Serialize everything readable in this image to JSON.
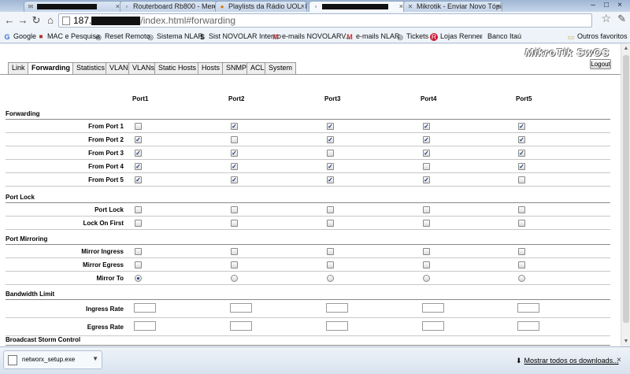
{
  "browser": {
    "tabs": [
      {
        "label": "",
        "icon": "mail-icon"
      },
      {
        "label": "Routerboard Rb800 - Merca",
        "icon": "page-icon"
      },
      {
        "label": "Playlists da Rádio UOL: Dan",
        "icon": "radio-icon"
      },
      {
        "label": "",
        "icon": "page-icon"
      },
      {
        "label": "Mikrotik - Enviar Novo Tópi",
        "icon": "tool-icon"
      }
    ],
    "tab_close": "×",
    "address": {
      "prefix": "187.",
      "rest": "/index.html#forwarding"
    },
    "bookmarks": [
      {
        "label": "Google",
        "icon": "google-icon"
      },
      {
        "label": "MAC e Pesquisa",
        "icon": "mac-icon"
      },
      {
        "label": "Reset Remoto",
        "icon": "globe-icon"
      },
      {
        "label": "Sistema NLAR",
        "icon": "globe-icon"
      },
      {
        "label": "Sist NOVOLAR Interno",
        "icon": "sist-icon"
      },
      {
        "label": "e-mails NOVOLARV...",
        "icon": "gmail-icon"
      },
      {
        "label": "e-mails NLAR",
        "icon": "gmail-icon"
      },
      {
        "label": "Tickets",
        "icon": "globe-icon"
      },
      {
        "label": "Lojas Renner",
        "icon": "renner-icon"
      },
      {
        "label": "Banco Itaú",
        "icon": "page-icon"
      },
      {
        "label": "Outros favoritos",
        "icon": "folder-icon"
      }
    ],
    "download": {
      "file": "networx_setup.exe"
    },
    "show_all_downloads": "Mostrar todos os downloads..."
  },
  "app": {
    "brand": "MikroTik SwOS",
    "logout": "Logout",
    "active_tab": "Forwarding",
    "tabs": [
      "Link",
      "Forwarding",
      "Statistics",
      "VLAN",
      "VLANs",
      "Static Hosts",
      "Hosts",
      "SNMP",
      "ACL",
      "System"
    ]
  },
  "ports": [
    "Port1",
    "Port2",
    "Port3",
    "Port4",
    "Port5"
  ],
  "sections": {
    "forwarding": {
      "title": "Forwarding",
      "rows": [
        {
          "label": "From Port 1",
          "values": [
            false,
            true,
            true,
            true,
            true
          ]
        },
        {
          "label": "From Port 2",
          "values": [
            true,
            false,
            true,
            true,
            true
          ]
        },
        {
          "label": "From Port 3",
          "values": [
            true,
            true,
            false,
            true,
            true
          ]
        },
        {
          "label": "From Port 4",
          "values": [
            true,
            true,
            true,
            false,
            true
          ]
        },
        {
          "label": "From Port 5",
          "values": [
            true,
            true,
            true,
            true,
            false
          ]
        }
      ]
    },
    "port_lock": {
      "title": "Port Lock",
      "rows": [
        {
          "label": "Port Lock",
          "values": [
            false,
            false,
            false,
            false,
            false
          ]
        },
        {
          "label": "Lock On First",
          "values": [
            false,
            false,
            false,
            false,
            false
          ]
        }
      ]
    },
    "port_mirroring": {
      "title": "Port Mirroring",
      "rows": [
        {
          "label": "Mirror Ingress",
          "values": [
            false,
            false,
            false,
            false,
            false
          ]
        },
        {
          "label": "Mirror Egress",
          "values": [
            false,
            false,
            false,
            false,
            false
          ]
        }
      ],
      "mirror_to": {
        "label": "Mirror To",
        "selected_port": 1
      }
    },
    "bandwidth_limit": {
      "title": "Bandwidth Limit",
      "rows": [
        {
          "label": "Ingress Rate",
          "values": [
            "",
            "",
            "",
            "",
            ""
          ]
        },
        {
          "label": "Egress Rate",
          "values": [
            "",
            "",
            "",
            "",
            ""
          ]
        }
      ]
    },
    "broadcast_storm": {
      "title": "Broadcast Storm Control"
    }
  }
}
